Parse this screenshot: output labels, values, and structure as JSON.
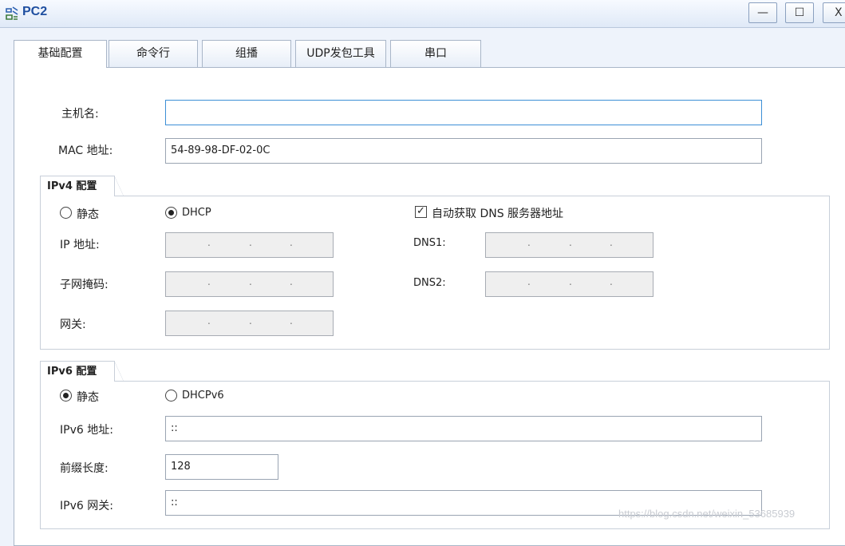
{
  "window": {
    "title": "PC2",
    "minimize": "—",
    "maximize": "☐",
    "close": "X"
  },
  "tabs": [
    {
      "label": "基础配置",
      "active": true
    },
    {
      "label": "命令行"
    },
    {
      "label": "组播"
    },
    {
      "label": "UDP发包工具"
    },
    {
      "label": "串口"
    }
  ],
  "basic": {
    "hostname_label": "主机名:",
    "hostname_value": "",
    "mac_label": "MAC 地址:",
    "mac_value": "54-89-98-DF-02-0C"
  },
  "ipv4": {
    "title": "IPv4 配置",
    "static_label": "静态",
    "dhcp_label": "DHCP",
    "selected": "DHCP",
    "auto_dns_label": "自动获取 DNS 服务器地址",
    "auto_dns_checked": true,
    "ip_label": "IP 地址:",
    "mask_label": "子网掩码:",
    "gateway_label": "网关:",
    "dns1_label": "DNS1:",
    "dns2_label": "DNS2:"
  },
  "ipv6": {
    "title": "IPv6 配置",
    "static_label": "静态",
    "dhcp_label": "DHCPv6",
    "selected": "静态",
    "addr_label": "IPv6 地址:",
    "addr_value": "::",
    "prefix_label": "前缀长度:",
    "prefix_value": "128",
    "gateway_label": "IPv6 网关:",
    "gateway_value": "::"
  },
  "watermark": "https://blog.csdn.net/weixin_53685939",
  "icons": {
    "app": "pc-network-icon"
  },
  "colors": {
    "title": "#1f4fa0",
    "focus_border": "#3c8fd6"
  }
}
